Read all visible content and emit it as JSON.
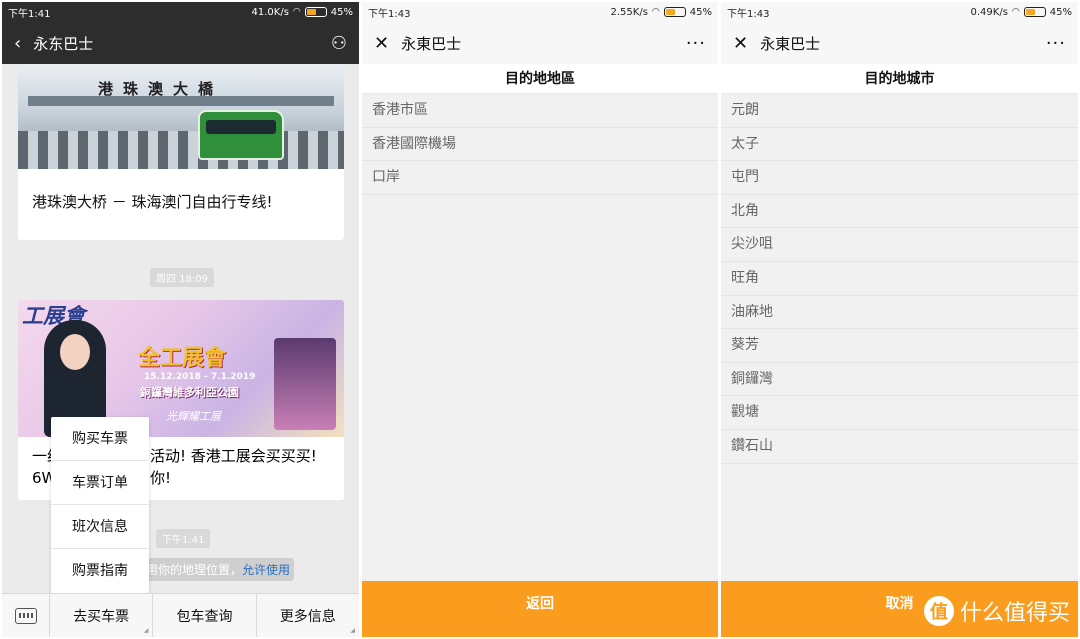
{
  "phone1": {
    "status": {
      "time": "下午1:41",
      "speed": "41.0K/s",
      "battery": "45%"
    },
    "nav": {
      "back_glyph": "‹",
      "title": "永东巴士",
      "user_glyph": "⚇"
    },
    "card1": {
      "banner_text": "港珠澳大橋",
      "caption": "港珠澳大桥 － 珠海澳门自由行专线!"
    },
    "time_chip1": "周四 18:09",
    "card2": {
      "logo_text": "工展會",
      "main_text": "全工展會",
      "date_text": "15.12.2018 - 7.1.2019",
      "place_text": "銅鑼灣維多利亞公園",
      "sub_text": "光輝耀工展",
      "caption_line1": "一分...活动! 香港工展会买买买!",
      "caption_line1_visible_left": "一约",
      "caption_line1_visible_right": "活动! 香港工展会买买买!",
      "caption_line2_left": "6W",
      "caption_line2_right": "你!"
    },
    "time_chip2": "下午1:41",
    "location_note": {
      "text": "用你的地理位置，",
      "link": "允许使用"
    },
    "popup_menu": [
      "购买车票",
      "车票订单",
      "班次信息",
      "购票指南"
    ],
    "bottom_menu": [
      "去买车票",
      "包车查询",
      "更多信息"
    ]
  },
  "phone2": {
    "status": {
      "time": "下午1:43",
      "speed": "2.55K/s",
      "battery": "45%"
    },
    "nav": {
      "close_glyph": "✕",
      "title": "永東巴士",
      "more_glyph": "···"
    },
    "section_title": "目的地地區",
    "rows": [
      "香港市區",
      "香港國際機場",
      "口岸"
    ],
    "button": "返回"
  },
  "phone3": {
    "status": {
      "time": "下午1:43",
      "speed": "0.49K/s",
      "battery": "45%"
    },
    "nav": {
      "close_glyph": "✕",
      "title": "永東巴士",
      "more_glyph": "···"
    },
    "section_title": "目的地城市",
    "rows": [
      "元朗",
      "太子",
      "屯門",
      "北角",
      "尖沙咀",
      "旺角",
      "油麻地",
      "葵芳",
      "銅鑼灣",
      "觀塘",
      "鑽石山"
    ],
    "button": "取消",
    "watermark": {
      "logo": "值",
      "text": "什么值得买"
    }
  },
  "colors": {
    "accent_orange": "#fa9d1f",
    "dark_bar": "#2d2d2d",
    "link_blue": "#2a6ebd"
  }
}
